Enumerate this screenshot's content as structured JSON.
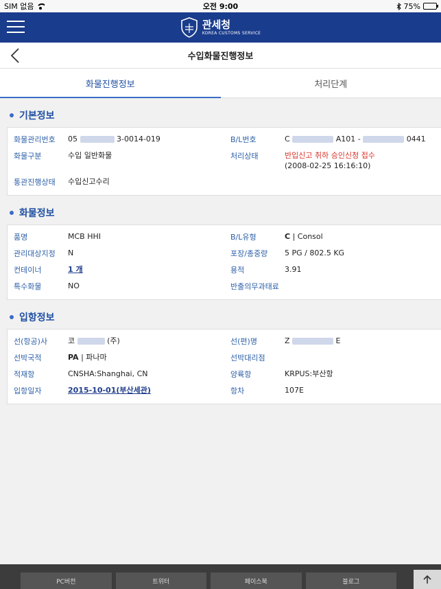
{
  "status_bar": {
    "carrier": "SIM 없음",
    "time": "오전 9:00",
    "battery": "75%",
    "battery_level": 0.75
  },
  "header": {
    "org_name_ko": "관세청",
    "org_name_en": "KOREA CUSTOMS SERVICE"
  },
  "subheader": {
    "title": "수입화물진행정보"
  },
  "tabs": [
    {
      "label": "화물진행정보",
      "active": true
    },
    {
      "label": "처리단계",
      "active": false
    }
  ],
  "basic_info": {
    "title": "기본정보",
    "cargo_no_label": "화물관리번호",
    "cargo_no_prefix": "05",
    "cargo_no_suffix": "3-0014-019",
    "bl_no_label": "B/L번호",
    "bl_no_prefix": "C",
    "bl_no_mid": "A101 -",
    "bl_no_suffix": "0441",
    "cargo_type_label": "화물구분",
    "cargo_type": "수입 일반화물",
    "process_status_label": "처리상태",
    "process_status": "반입신고 취하 승인신청 접수",
    "process_status_time": "(2008-02-25 16:16:10)",
    "clearance_label": "통관진행상태",
    "clearance": "수입신고수리"
  },
  "cargo_info": {
    "title": "화물정보",
    "item_label": "품명",
    "item": "MCB HHI",
    "bl_type_label": "B/L유형",
    "bl_type_code": "C",
    "bl_type_name": "| Consol",
    "managed_label": "관리대상지정",
    "managed": "N",
    "pkg_label": "포장/총중량",
    "pkg": "5 PG / 802.5 KG",
    "container_label": "컨테이너",
    "container": "1 개",
    "volume_label": "용적",
    "volume": "3.91",
    "special_label": "특수화물",
    "special": "NO",
    "obligation_label": "반출의무과태료",
    "obligation": ""
  },
  "entry_info": {
    "title": "입항정보",
    "carrier_label": "선(항공)사",
    "carrier_prefix": "코",
    "carrier_suffix": "(주)",
    "vessel_label": "선(편)명",
    "vessel_prefix": "Z",
    "vessel_suffix": "E",
    "nationality_label": "선박국적",
    "nationality_code": "PA",
    "nationality_name": "| 파나마",
    "agent_label": "선박대리점",
    "agent": "",
    "loading_label": "적재항",
    "loading": "CNSHA:Shanghai, CN",
    "unloading_label": "양륙항",
    "unloading": "KRPUS:부산항",
    "entry_date_label": "입항일자",
    "entry_date": "2015-10-01(부산세관)",
    "voyage_label": "항차",
    "voyage": "107E"
  },
  "footer": {
    "links": [
      "PC버전",
      "트위터",
      "페이스북",
      "블로그"
    ]
  },
  "colors": {
    "header_bg": "#1a3c8c",
    "accent": "#3a6bc8",
    "label": "#2c5fa8",
    "alert": "#d9342b"
  }
}
